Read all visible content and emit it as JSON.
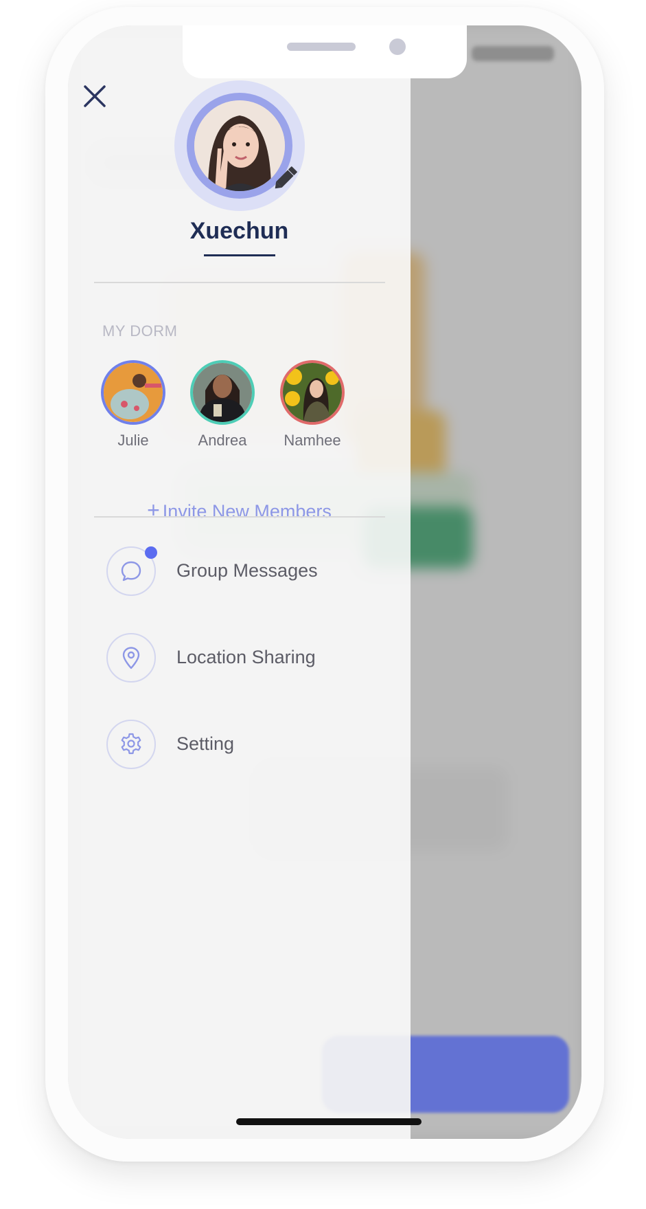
{
  "profile": {
    "name": "Xuechun",
    "avatar_icon": "profile-photo",
    "edit_icon": "pencil-icon"
  },
  "header": {
    "close_icon": "close-icon"
  },
  "dorm": {
    "section_label": "MY DORM",
    "members": [
      {
        "name": "Julie",
        "ring_color": "#7080ea",
        "bg_color": "#e79a3c"
      },
      {
        "name": "Andrea",
        "ring_color": "#4ecdb6",
        "bg_color": "#2c3a3f"
      },
      {
        "name": "Namhee",
        "ring_color": "#e06a6a",
        "bg_color": "#f0c12a"
      }
    ],
    "invite_plus": "+",
    "invite_label": "Invite New Members"
  },
  "menu": {
    "items": [
      {
        "label": "Group Messages",
        "icon": "chat-bubble-icon",
        "has_badge": true
      },
      {
        "label": "Location Sharing",
        "icon": "location-pin-icon",
        "has_badge": false
      },
      {
        "label": "Setting",
        "icon": "gear-icon",
        "has_badge": false
      }
    ]
  },
  "colors": {
    "accent": "#5b6cf0",
    "name_text": "#1f2d55",
    "icon_stroke": "#8d97e6"
  }
}
